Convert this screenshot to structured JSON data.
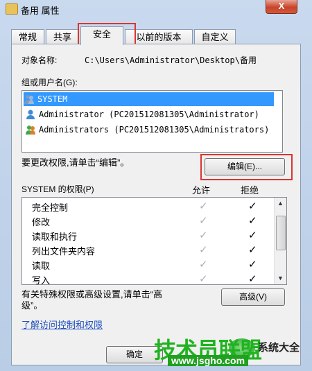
{
  "window": {
    "title": "备用 属性",
    "close": "X"
  },
  "tabs": [
    "常规",
    "共享",
    "安全",
    "以前的版本",
    "自定义"
  ],
  "object": {
    "label": "对象名称:",
    "value": "C:\\Users\\Administrator\\Desktop\\备用"
  },
  "groups": {
    "label": "组或用户名(G):",
    "items": [
      "SYSTEM",
      "Administrator (PC201512081305\\Administrator)",
      "Administrators (PC201512081305\\Administrators)"
    ]
  },
  "edit": {
    "hint": "要更改权限,请单击“编辑”。",
    "button": "编辑(E)..."
  },
  "perms": {
    "label": "SYSTEM 的权限(P)",
    "allow": "允许",
    "deny": "拒绝",
    "rows": [
      "完全控制",
      "修改",
      "读取和执行",
      "列出文件夹内容",
      "读取",
      "写入"
    ]
  },
  "advanced": {
    "hint_line1": "有关特殊权限或高级设置,请单击“高",
    "hint_line2": "级”。",
    "button": "高级(V)"
  },
  "link": "了解访问控制和权限",
  "ok": "确定",
  "watermark": {
    "main": "技术员联盟",
    "url": "www.jsgho.com",
    "side": "系统大全"
  },
  "colors": {
    "selection": "#3399ff",
    "highlight_box": "#d9362e",
    "link": "#1e4fbf"
  }
}
